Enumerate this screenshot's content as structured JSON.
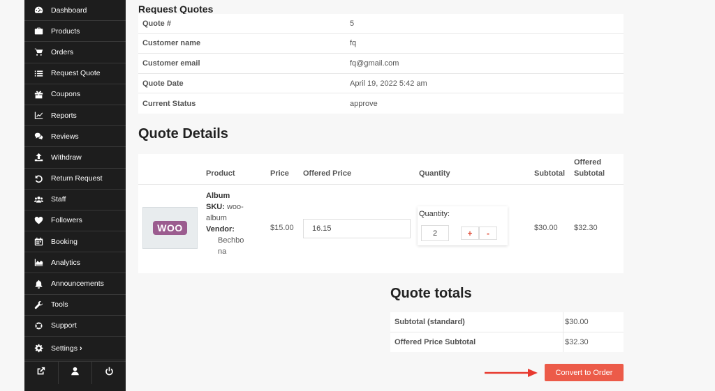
{
  "sidebar": {
    "items": [
      {
        "label": "Dashboard",
        "icon": "dashboard-icon"
      },
      {
        "label": "Products",
        "icon": "briefcase-icon"
      },
      {
        "label": "Orders",
        "icon": "cart-icon"
      },
      {
        "label": "Request Quote",
        "icon": "list-icon"
      },
      {
        "label": "Coupons",
        "icon": "gift-icon"
      },
      {
        "label": "Reports",
        "icon": "line-chart-icon"
      },
      {
        "label": "Reviews",
        "icon": "comments-icon"
      },
      {
        "label": "Withdraw",
        "icon": "upload-icon"
      },
      {
        "label": "Return Request",
        "icon": "undo-icon"
      },
      {
        "label": "Staff",
        "icon": "users-icon"
      },
      {
        "label": "Followers",
        "icon": "heart-icon"
      },
      {
        "label": "Booking",
        "icon": "calendar-icon"
      },
      {
        "label": "Analytics",
        "icon": "area-chart-icon"
      },
      {
        "label": "Announcements",
        "icon": "bell-icon"
      },
      {
        "label": "Tools",
        "icon": "wrench-icon"
      },
      {
        "label": "Support",
        "icon": "lifebuoy-icon"
      },
      {
        "label": "Settings",
        "icon": "gear-icon"
      }
    ],
    "settings_chevron": "›",
    "footer": [
      "external-link-icon",
      "user-icon",
      "power-icon"
    ]
  },
  "request": {
    "title": "Request Quotes",
    "rows": [
      {
        "label": "Quote #",
        "value": "5"
      },
      {
        "label": "Customer name",
        "value": "fq"
      },
      {
        "label": "Customer email",
        "value": "fq@gmail.com"
      },
      {
        "label": "Quote Date",
        "value": "April 19, 2022 5:42 am"
      },
      {
        "label": "Current Status",
        "value": "approve"
      }
    ]
  },
  "details": {
    "title": "Quote Details",
    "headers": {
      "product": "Product",
      "price": "Price",
      "offered_price": "Offered Price",
      "quantity": "Quantity",
      "subtotal": "Subtotal",
      "offered_subtotal_1": "Offered",
      "offered_subtotal_2": "Subtotal"
    },
    "item": {
      "thumb_text": "WOO",
      "name": "Album",
      "sku_label": "SKU:",
      "sku_1": "woo-",
      "sku_2": "album",
      "vendor_label": "Vendor:",
      "vendor_1": "Bechbo",
      "vendor_2": "na",
      "price": "$15.00",
      "offered_price": "16.15",
      "quantity_label": "Quantity:",
      "quantity": "2",
      "plus": "+",
      "minus": "-",
      "subtotal": "$30.00",
      "offered_subtotal": "$32.30"
    }
  },
  "totals": {
    "title": "Quote totals",
    "rows": [
      {
        "label": "Subtotal (standard)",
        "value": "$30.00"
      },
      {
        "label": "Offered Price Subtotal",
        "value": "$32.30"
      }
    ]
  },
  "actions": {
    "convert_label": "Convert to Order"
  },
  "colors": {
    "sidebar_bg": "#1d1d1d",
    "accent": "#ec5b49",
    "arrow": "#e8392f"
  }
}
